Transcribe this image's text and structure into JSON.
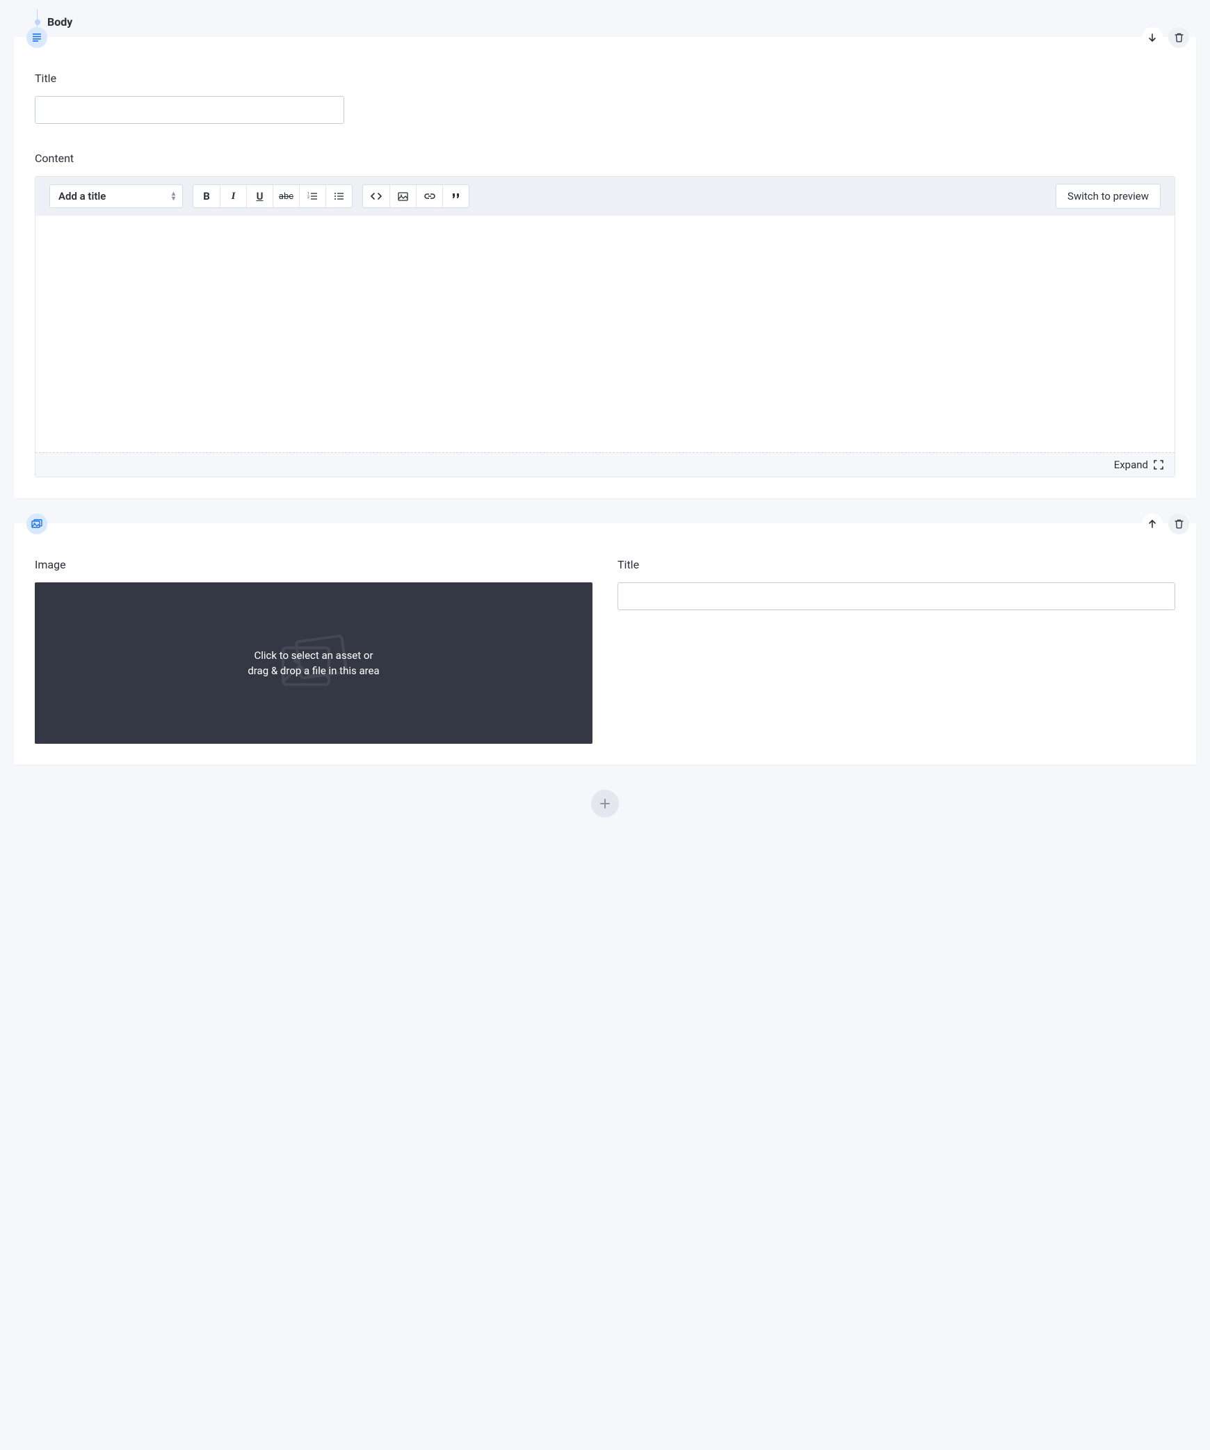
{
  "section": {
    "label": "Body"
  },
  "textBlock": {
    "titleLabel": "Title",
    "titleValue": "",
    "contentLabel": "Content",
    "toolbar": {
      "styleSelect": "Add a title",
      "bold": "B",
      "italic": "I",
      "underline": "U",
      "strike": "abc",
      "previewLabel": "Switch to preview"
    },
    "expandLabel": "Expand"
  },
  "imageBlock": {
    "imageLabel": "Image",
    "dropLine1": "Click to select an asset or",
    "dropLine2": "drag & drop a file in this area",
    "titleLabel": "Title",
    "titleValue": ""
  },
  "icons": {
    "text": "text-lines-icon",
    "image": "image-icon",
    "down": "arrow-down-icon",
    "up": "arrow-up-icon",
    "trash": "trash-icon",
    "plus": "plus-icon",
    "expand": "expand-icon"
  }
}
